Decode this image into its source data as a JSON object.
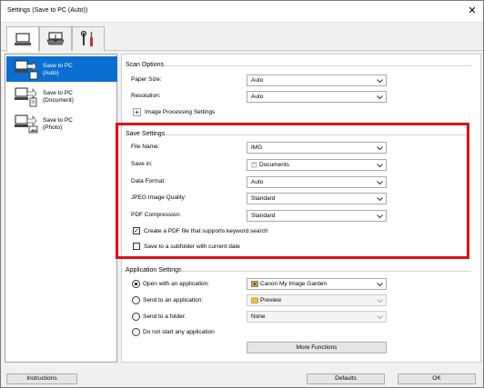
{
  "window": {
    "title": "Settings (Save to PC (Auto))"
  },
  "tabs": [
    {
      "icon": "computer-scan-icon"
    },
    {
      "icon": "scanner-general-icon"
    },
    {
      "icon": "tools-icon"
    }
  ],
  "sidebar": {
    "items": [
      {
        "line1": "Save to PC",
        "line2": "(Auto)",
        "selected": true
      },
      {
        "line1": "Save to PC",
        "line2": "(Document)",
        "selected": false
      },
      {
        "line1": "Save to PC",
        "line2": "(Photo)",
        "selected": false
      }
    ]
  },
  "scan_options": {
    "title": "Scan Options",
    "paper_size_label": "Paper Size:",
    "paper_size_value": "Auto",
    "resolution_label": "Resolution:",
    "resolution_value": "Auto",
    "image_processing_label": "Image Processing Settings"
  },
  "save_settings": {
    "title": "Save Settings",
    "file_name_label": "File Name:",
    "file_name_value": "IMG",
    "save_in_label": "Save in:",
    "save_in_value": "Documents",
    "data_format_label": "Data Format:",
    "data_format_value": "Auto",
    "jpeg_quality_label": "JPEG Image Quality:",
    "jpeg_quality_value": "Standard",
    "pdf_compression_label": "PDF Compression:",
    "pdf_compression_value": "Standard",
    "keyword_pdf_label": "Create a PDF file that supports keyword search",
    "keyword_pdf_checked": true,
    "subfolder_label": "Save to a subfolder with current date",
    "subfolder_checked": false
  },
  "application_settings": {
    "title": "Application Settings",
    "open_app_label": "Open with an application:",
    "open_app_value": "Canon My Image Garden",
    "send_app_label": "Send to an application:",
    "send_app_value": "Preview",
    "send_folder_label": "Send to a folder:",
    "send_folder_value": "None",
    "no_app_label": "Do not start any application",
    "more_functions_label": "More Functions",
    "selected": "open_app"
  },
  "footer": {
    "instructions_label": "Instructions",
    "defaults_label": "Defaults",
    "ok_label": "OK"
  },
  "colors": {
    "selection": "#0a6fd0",
    "highlight_border": "#e10f15"
  }
}
